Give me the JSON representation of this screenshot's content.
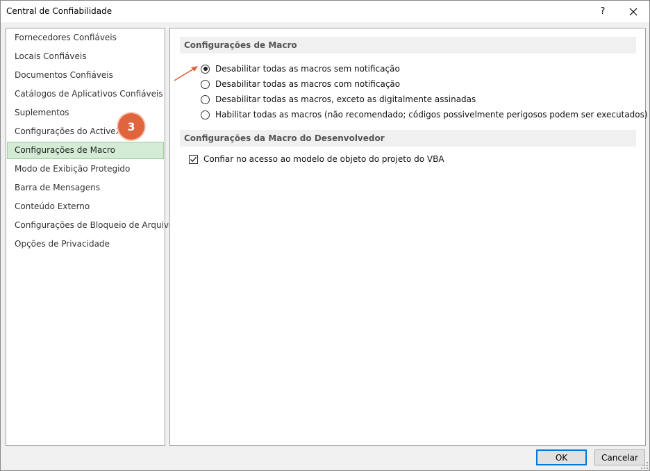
{
  "window": {
    "title": "Central de Confiabilidade",
    "help_label": "?"
  },
  "sidebar": {
    "items": [
      {
        "label": "Fornecedores Confiáveis"
      },
      {
        "label": "Locais Confiáveis"
      },
      {
        "label": "Documentos Confiáveis"
      },
      {
        "label": "Catálogos de Aplicativos Confiáveis"
      },
      {
        "label": "Suplementos"
      },
      {
        "label": "Configurações do ActiveX"
      },
      {
        "label": "Configurações de Macro",
        "selected": true
      },
      {
        "label": "Modo de Exibição Protegido"
      },
      {
        "label": "Barra de Mensagens"
      },
      {
        "label": "Conteúdo Externo"
      },
      {
        "label": "Configurações de Bloqueio de Arquivo"
      },
      {
        "label": "Opções de Privacidade"
      }
    ]
  },
  "annotation": {
    "step_number": "3",
    "accent_color": "#e0643c"
  },
  "macro_settings": {
    "header": "Configurações de Macro",
    "options": [
      {
        "label": "Desabilitar todas as macros sem notificação",
        "checked": true
      },
      {
        "label": "Desabilitar todas as macros com notificação",
        "checked": false
      },
      {
        "label": "Desabilitar todas as macros, exceto as digitalmente assinadas",
        "checked": false
      },
      {
        "label": "Habilitar todas as macros (não recomendado; códigos possivelmente perigosos podem ser executados)",
        "checked": false
      }
    ]
  },
  "developer_settings": {
    "header": "Configurações da Macro do Desenvolvedor",
    "vba_access_label": "Confiar no acesso ao modelo de objeto do projeto do VBA",
    "vba_access_checked": true
  },
  "buttons": {
    "ok_label": "OK",
    "cancel_label": "Cancelar"
  },
  "icons": {
    "close": "close-icon",
    "arrow": "arrow-icon",
    "check": "checkmark-icon"
  }
}
